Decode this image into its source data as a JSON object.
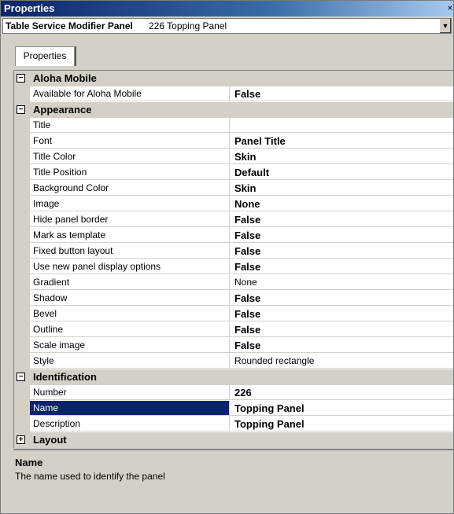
{
  "window": {
    "title": "Properties",
    "close_glyph": "×"
  },
  "object_selector": {
    "type_label": "Table Service Modifier Panel",
    "instance_label": "226 Topping Panel"
  },
  "tabs": [
    {
      "label": "Properties"
    }
  ],
  "groups": [
    {
      "label": "Aloha Mobile",
      "toggle": "−",
      "props": [
        {
          "name": "Available for Aloha Mobile",
          "value": "False",
          "bold": true
        }
      ]
    },
    {
      "label": "Appearance",
      "toggle": "−",
      "props": [
        {
          "name": "Title",
          "value": "",
          "bold": true
        },
        {
          "name": "Font",
          "value": "Panel Title",
          "bold": true
        },
        {
          "name": "Title Color",
          "value": "Skin",
          "bold": true
        },
        {
          "name": "Title Position",
          "value": "Default",
          "bold": true
        },
        {
          "name": "Background Color",
          "value": "Skin",
          "bold": true
        },
        {
          "name": "Image",
          "value": "None",
          "bold": true
        },
        {
          "name": "Hide panel border",
          "value": "False",
          "bold": true
        },
        {
          "name": "Mark as template",
          "value": "False",
          "bold": true
        },
        {
          "name": "Fixed button layout",
          "value": "False",
          "bold": true
        },
        {
          "name": "Use new panel display options",
          "value": "False",
          "bold": true
        },
        {
          "name": "Gradient",
          "value": "None",
          "bold": false
        },
        {
          "name": "Shadow",
          "value": "False",
          "bold": true
        },
        {
          "name": "Bevel",
          "value": "False",
          "bold": true
        },
        {
          "name": "Outline",
          "value": "False",
          "bold": true
        },
        {
          "name": "Scale image",
          "value": "False",
          "bold": true
        },
        {
          "name": "Style",
          "value": "Rounded rectangle",
          "bold": false
        }
      ]
    },
    {
      "label": "Identification",
      "toggle": "−",
      "props": [
        {
          "name": "Number",
          "value": "226",
          "bold": true
        },
        {
          "name": "Name",
          "value": "Topping Panel",
          "bold": true,
          "selected": true
        },
        {
          "name": "Description",
          "value": "Topping Panel",
          "bold": true
        }
      ]
    },
    {
      "label": "Layout",
      "toggle": "+",
      "props": []
    }
  ],
  "description": {
    "title": "Name",
    "text": "The name used to identify the panel"
  },
  "colors": {
    "selection": "#0a246a",
    "titlebar": "#0a246a",
    "face": "#d4d0c8"
  }
}
